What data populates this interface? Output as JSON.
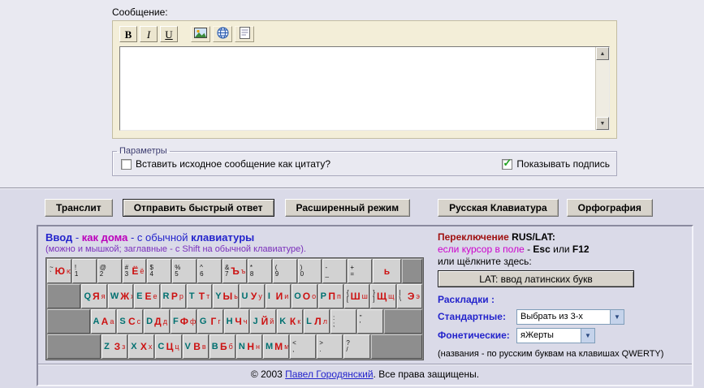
{
  "message": {
    "label": "Сообщение:",
    "toolbar": {
      "bold": "B",
      "italic": "I",
      "underline": "U"
    },
    "textarea_value": ""
  },
  "params": {
    "legend": "Параметры",
    "quote_label": "Вставить исходное сообщение как цитату?",
    "quote_checked": false,
    "signature_label": "Показывать подпись",
    "signature_checked": true
  },
  "actions": [
    {
      "label": "Транслит"
    },
    {
      "label": "Отправить быстрый ответ",
      "focused": true
    },
    {
      "label": "Расширенный режим"
    },
    {
      "label": "Русская Клавиатура"
    },
    {
      "label": "Орфография"
    }
  ],
  "kbd_header": {
    "t1": "Ввод",
    "t2": " - ",
    "t3": "как дома",
    "t4": " - с обычной ",
    "t5": "клавиатуры",
    "subtitle": "(можно и мышкой; заглавные - с Shift на обычной клавиатуре)."
  },
  "switcher": {
    "l1a": "Переключение ",
    "l1b": "RUS/LAT:",
    "l2a": "если курсор в поле",
    "l2b": " - ",
    "l2c": "Esc",
    "l2d": " или ",
    "l2e": "F12",
    "l3": "или щёлкните здесь:",
    "lat_button": "LAT: ввод латинских букв"
  },
  "layouts": {
    "title": "Раскладки :",
    "standard_label": "Стандартные:",
    "standard_value": "Выбрать из 3-х",
    "phonetic_label": "Фонетические:",
    "phonetic_value": "яЖерты",
    "note": "(названия - по русским буквам на клавишах QWERTY)"
  },
  "footer": {
    "c1": "© 2003 ",
    "link": "Павел Городянский",
    "c2": ". Все права защищены."
  },
  "colors": {
    "accent_blue": "#2424cc",
    "accent_magenta": "#cc00cc",
    "accent_maroon": "#a01010",
    "rus_letter": "#cc1111",
    "lat_letter": "#007070",
    "check_green": "#23a123"
  },
  "keyboard": {
    "rows": [
      [
        {
          "sym": "~",
          "sym2": "`",
          "rus": "Ю",
          "rus2": "ю"
        },
        {
          "sym": "!",
          "sym2": "1"
        },
        {
          "sym": "@",
          "sym2": "2"
        },
        {
          "sym": "#",
          "sym2": "3",
          "rus": "Ё",
          "rus2": "ё"
        },
        {
          "sym": "$",
          "sym2": "4"
        },
        {
          "sym": "%",
          "sym2": "5"
        },
        {
          "sym": "^",
          "sym2": "6"
        },
        {
          "sym": "&",
          "sym2": "7",
          "rus": "Ъ",
          "rus2": "ъ"
        },
        {
          "sym": "*",
          "sym2": "8"
        },
        {
          "sym": "(",
          "sym2": "9"
        },
        {
          "sym": ")",
          "sym2": "0"
        },
        {
          "sym": "-",
          "sym2": "_"
        },
        {
          "sym": "+",
          "sym2": "="
        },
        {
          "rus": "ь",
          "flex": 1.2
        },
        {
          "dark": true,
          "flex": 0.8
        }
      ],
      [
        {
          "dark": true,
          "flex": 1.4
        },
        {
          "lat": "Q",
          "rus": "Я",
          "rus2": "я"
        },
        {
          "lat": "W",
          "rus": "Ж",
          "rus2": "ж"
        },
        {
          "lat": "E",
          "rus": "Е",
          "rus2": "е"
        },
        {
          "lat": "R",
          "rus": "Р",
          "rus2": "р"
        },
        {
          "lat": "T",
          "rus": "Т",
          "rus2": "т"
        },
        {
          "lat": "Y",
          "rus": "Ы",
          "rus2": "ы"
        },
        {
          "lat": "U",
          "rus": "У",
          "rus2": "у"
        },
        {
          "lat": "I",
          "rus": "И",
          "rus2": "и"
        },
        {
          "lat": "O",
          "rus": "О",
          "rus2": "о"
        },
        {
          "lat": "P",
          "rus": "П",
          "rus2": "п"
        },
        {
          "sym": "{",
          "sym2": "[",
          "rus": "Ш",
          "rus2": "ш"
        },
        {
          "sym": "}",
          "sym2": "]",
          "rus": "Щ",
          "rus2": "щ"
        },
        {
          "sym": "|",
          "sym2": "\\",
          "rus": "Э",
          "rus2": "э"
        }
      ],
      [
        {
          "dark": true,
          "flex": 1.8
        },
        {
          "lat": "A",
          "rus": "А",
          "rus2": "а"
        },
        {
          "lat": "S",
          "rus": "С",
          "rus2": "с"
        },
        {
          "lat": "D",
          "rus": "Д",
          "rus2": "д"
        },
        {
          "lat": "F",
          "rus": "Ф",
          "rus2": "ф"
        },
        {
          "lat": "G",
          "rus": "Г",
          "rus2": "г"
        },
        {
          "lat": "H",
          "rus": "Ч",
          "rus2": "ч"
        },
        {
          "lat": "J",
          "rus": "Й",
          "rus2": "й"
        },
        {
          "lat": "K",
          "rus": "К",
          "rus2": "к"
        },
        {
          "lat": "L",
          "rus": "Л",
          "rus2": "л"
        },
        {
          "sym": ":",
          "sym2": ";"
        },
        {
          "sym": "\"",
          "sym2": "'"
        },
        {
          "dark": true,
          "flex": 1.6
        }
      ],
      [
        {
          "dark": true,
          "flex": 2.3
        },
        {
          "lat": "Z",
          "rus": "З",
          "rus2": "з"
        },
        {
          "lat": "X",
          "rus": "Х",
          "rus2": "х"
        },
        {
          "lat": "C",
          "rus": "Ц",
          "rus2": "ц"
        },
        {
          "lat": "V",
          "rus": "В",
          "rus2": "в"
        },
        {
          "lat": "B",
          "rus": "Б",
          "rus2": "б"
        },
        {
          "lat": "N",
          "rus": "Н",
          "rus2": "н"
        },
        {
          "lat": "M",
          "rus": "М",
          "rus2": "м"
        },
        {
          "sym": "<",
          "sym2": ","
        },
        {
          "sym": ">",
          "sym2": "."
        },
        {
          "sym": "?",
          "sym2": "/"
        },
        {
          "dark": true,
          "flex": 2.2
        }
      ]
    ]
  }
}
